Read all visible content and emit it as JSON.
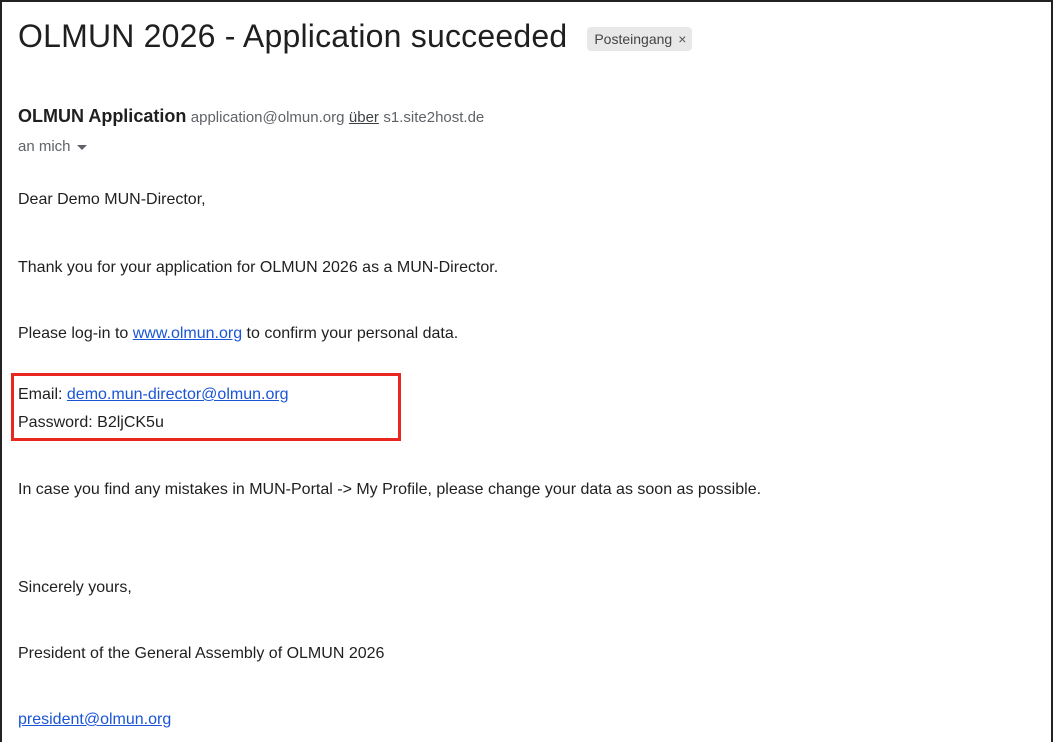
{
  "email": {
    "subject": "OLMUN 2026 - Application succeeded",
    "label": "Posteingang",
    "label_close": "×",
    "sender_name": "OLMUN Application",
    "sender_email": "application@olmun.org",
    "via_text": "über",
    "via_host": "s1.site2host.de",
    "recipient": "an mich",
    "body": {
      "greeting": "Dear Demo MUN-Director,",
      "thanks": "Thank you for your application for OLMUN 2026 as a MUN-Director.",
      "login_prefix": "Please log-in to ",
      "login_link": "www.olmun.org",
      "login_suffix": " to confirm your personal data.",
      "email_label": "Email: ",
      "email_value": "demo.mun-director@olmun.org",
      "password_label": "Password: ",
      "password_value": "B2ljCK5u",
      "mistakes": "In case you find any mistakes in MUN-Portal -> My Profile, please change your data as soon as possible.",
      "closing": "Sincerely yours,",
      "signature": "President of the General Assembly of OLMUN 2026",
      "signature_email": "president@olmun.org"
    }
  },
  "colors": {
    "highlight": "#e8281e",
    "link": "#1a55d6"
  }
}
